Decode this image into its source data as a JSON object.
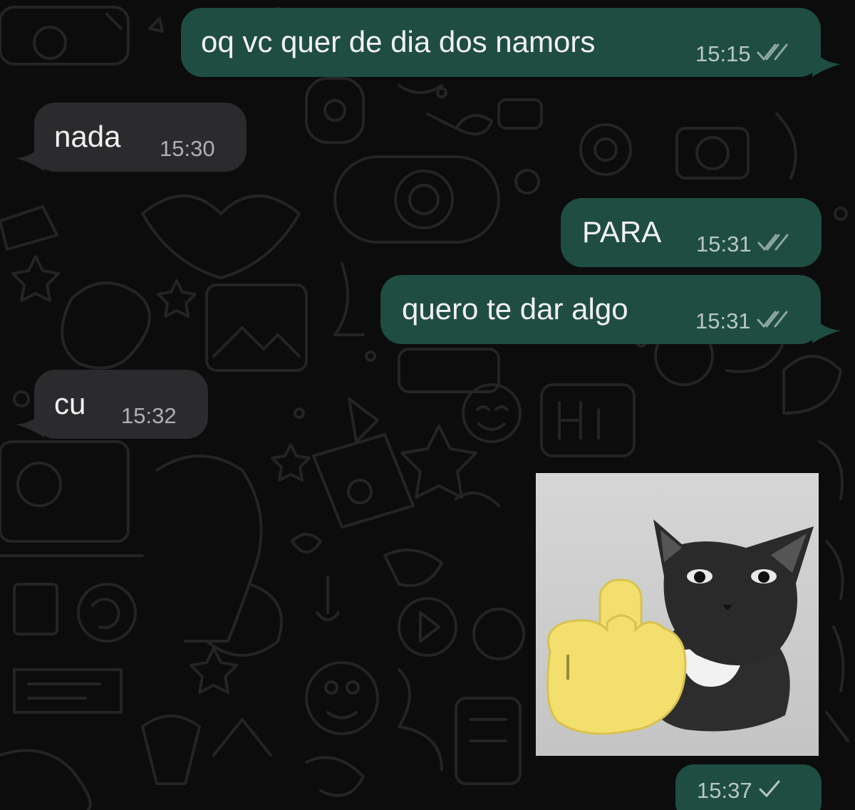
{
  "conversation": {
    "messages": [
      {
        "direction": "outgoing",
        "text": "oq vc quer de dia dos namors",
        "time": "15:15",
        "status": "read-double-check"
      },
      {
        "direction": "incoming",
        "text": "nada",
        "time": "15:30"
      },
      {
        "direction": "outgoing",
        "text": "PARA",
        "time": "15:31",
        "status": "read-double-check"
      },
      {
        "direction": "outgoing",
        "text": "quero te dar algo",
        "time": "15:31",
        "status": "read-double-check"
      },
      {
        "direction": "incoming",
        "text": "cu",
        "time": "15:32"
      },
      {
        "direction": "outgoing",
        "type": "image",
        "image_content": "cat with middle finger emoji",
        "time": "15:37",
        "status": "sent-single-check"
      }
    ]
  },
  "colors": {
    "background": "#0c0c0c",
    "outgoing_bubble": "#1f4d42",
    "incoming_bubble": "#2b2b2d",
    "text": "#f2f2f2"
  },
  "icons": [
    "double-check-icon",
    "single-check-icon",
    "whatsapp-doodle-wallpaper"
  ]
}
